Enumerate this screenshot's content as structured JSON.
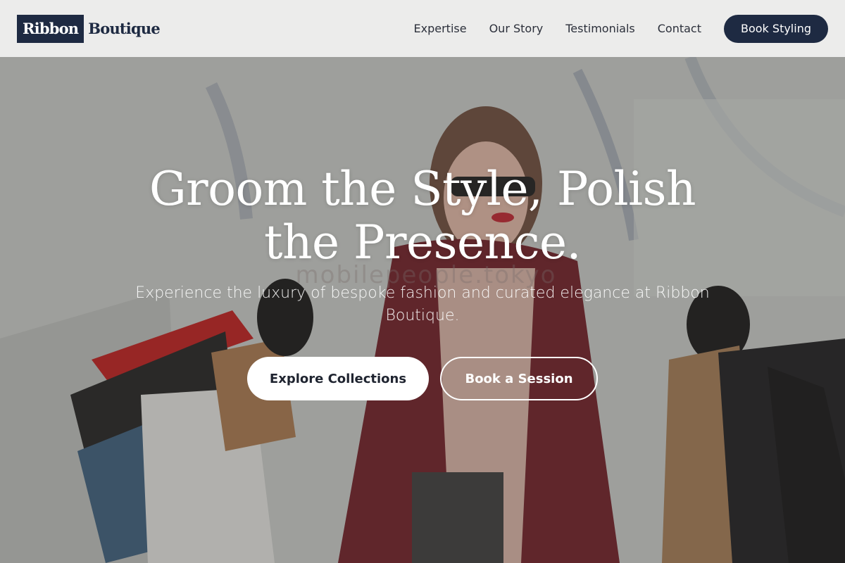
{
  "header": {
    "logo_primary": "Ribbon",
    "logo_secondary": "Boutique",
    "nav": [
      {
        "label": "Expertise"
      },
      {
        "label": "Our Story"
      },
      {
        "label": "Testimonials"
      },
      {
        "label": "Contact"
      }
    ],
    "cta_label": "Book Styling"
  },
  "hero": {
    "title_line1": "Groom the Style, Polish",
    "title_line2": "the Presence.",
    "subtitle": "Experience the luxury of bespoke fashion and curated elegance at Ribbon Boutique.",
    "primary_cta": "Explore Collections",
    "secondary_cta": "Book a Session",
    "watermark": "mobilepeople.tokyo"
  },
  "colors": {
    "brand_navy": "#1e2a42",
    "header_bg": "#ececeb",
    "coat_red": "#6e1a24"
  }
}
